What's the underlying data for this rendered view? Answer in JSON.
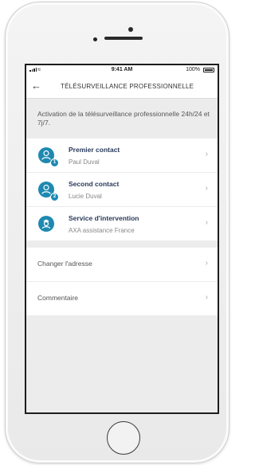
{
  "status_bar": {
    "time": "9:41 AM",
    "battery": "100%"
  },
  "appbar": {
    "title": "TÉLÉSURVEILLANCE PROFESSIONNELLE"
  },
  "intro": "Activation de la télésurveillance professionnelle 24h/24 et 7j/7.",
  "contacts": [
    {
      "name": "Premier contact",
      "sub": "Paul Duval",
      "badge": "1",
      "icon": "person-icon"
    },
    {
      "name": "Second contact",
      "sub": "Lucie Duval",
      "badge": "2",
      "icon": "person-icon"
    },
    {
      "name": "Service d'intervention",
      "sub": "AXA assistance France",
      "icon": "security-guard-icon"
    }
  ],
  "settings": [
    {
      "label": "Changer l'adresse"
    },
    {
      "label": "Commentaire"
    }
  ],
  "colors": {
    "accent": "#1e89b0",
    "background": "#ececec"
  }
}
